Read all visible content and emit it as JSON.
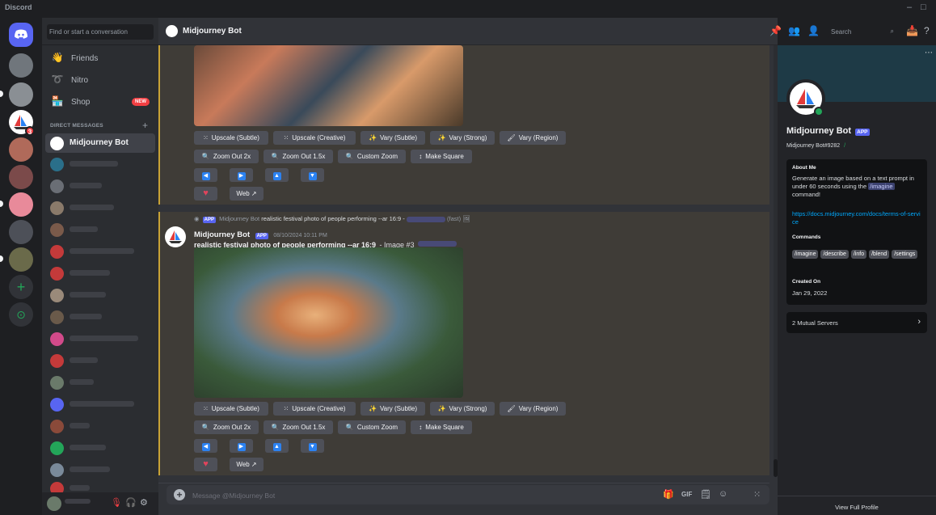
{
  "app": {
    "name": "Discord"
  },
  "window": {
    "minimize": "–",
    "maximize": "□"
  },
  "colors": {
    "blurple": "#5865f2",
    "online": "#23a559",
    "danger": "#f23f43",
    "embed_border": "#c9a336"
  },
  "guilds": [
    {
      "icon": "discord-home-icon",
      "label": ""
    },
    {
      "icon": "sailboat-icon",
      "label": ""
    },
    {
      "icon": "add-server-icon",
      "label": "+"
    },
    {
      "icon": "discover-icon",
      "label": "⊙"
    }
  ],
  "dm_sidebar": {
    "search_placeholder": "Find or start a conversation",
    "nav": [
      {
        "label": "Friends",
        "icon": "friends-icon"
      },
      {
        "label": "Nitro",
        "icon": "nitro-icon"
      },
      {
        "label": "Shop",
        "icon": "shop-icon",
        "badge": "NEW"
      }
    ],
    "dm_header": "DIRECT MESSAGES",
    "active_dm": "Midjourney Bot"
  },
  "channel": {
    "title": "Midjourney Bot"
  },
  "search": {
    "placeholder": "Search"
  },
  "messages": {
    "buttons": {
      "upscale_subtle": "Upscale (Subtle)",
      "upscale_creative": "Upscale (Creative)",
      "vary_subtle": "Vary (Subtle)",
      "vary_strong": "Vary (Strong)",
      "vary_region": "Vary (Region)",
      "zoom_out_2x": "Zoom Out 2x",
      "zoom_out_15x": "Zoom Out 1.5x",
      "custom_zoom": "Custom Zoom",
      "make_square": "Make Square",
      "web": "Web"
    },
    "second": {
      "ref_tag": "APP",
      "ref_author": "Midjourney Bot",
      "ref_prompt": "realistic festival photo of people performing --ar 16:9 -",
      "ref_mode": "(fast)",
      "author": "Midjourney Bot",
      "tag": "APP",
      "timestamp": "08/10/2024 10:11 PM",
      "prompt": "realistic festival photo of people performing --ar 16:9",
      "image_suffix": "- Image #3"
    }
  },
  "composer": {
    "placeholder": "Message @Midjourney Bot"
  },
  "profile": {
    "name": "Midjourney Bot",
    "tag": "APP",
    "username": "Midjourney Bot#9282",
    "about_header": "About Me",
    "about_text_1": "Generate an image based on a text prompt in under 60 seconds using the",
    "about_cmd": "/imagine",
    "about_text_2": "command!",
    "link": "https://docs.midjourney.com/docs/terms-of-service",
    "commands_header": "Commands",
    "commands": [
      "/imagine",
      "/describe",
      "/info",
      "/blend",
      "/settings"
    ],
    "created_header": "Created On",
    "created": "Jan 29, 2022",
    "mutual": "2 Mutual Servers",
    "view_full": "View Full Profile"
  }
}
